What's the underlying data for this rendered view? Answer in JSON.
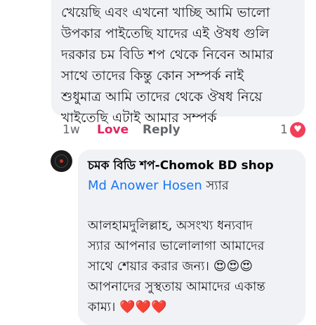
{
  "comment1": {
    "lines": [
      "খেয়েছি এবং এখনো খাচ্ছি আমি ভালো",
      "উপকার পাইতেছি যাদের এই ঔষধ গুলি",
      "দরকার চম বিডি শপ থেকে নিবেন আমার",
      "সাথে তাদের কিন্তু কোন সম্পর্ক নাই",
      "শুধুমাত্র আমি তাদের থেকে ঔষধ নিয়ে",
      "খাইতেছি এটাই আমার সম্পর্ক"
    ],
    "time": "1w",
    "love_label": "Love",
    "reply_label": "Reply",
    "reaction_count": "1",
    "reaction_icon": "heart-icon"
  },
  "reply": {
    "avatar_icon": "page-avatar",
    "author": "চমক বিডি শপ-Chomok BD shop",
    "mention": "Md Anower Hosen",
    "mention_suffix": " স্যার",
    "body_lines": [
      "আলহামদুলিল্লাহ, অসংখ্য ধন্যবাদ",
      "স্যার  আপনার ভালোলাগা আমাদের",
      "সাথে শেয়ার করার জন্য। ",
      "আপনাদের সুস্থতায় আমাদের একান্ত",
      "কাম্য। "
    ],
    "emoji_line3": "😍😍😍",
    "emoji_line5": "❤️❤️❤️"
  },
  "colors": {
    "bubble": "#f0f2f5",
    "love": "#e0245e",
    "link": "#1877f2",
    "meta": "#65676b"
  }
}
